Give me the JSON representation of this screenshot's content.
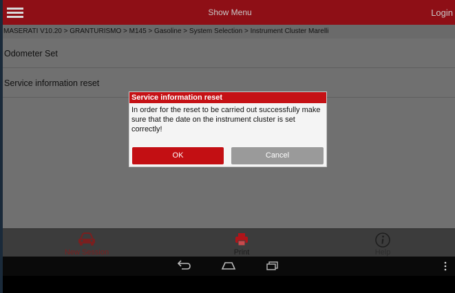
{
  "topbar": {
    "title": "Show Menu",
    "login_label": "Login"
  },
  "breadcrumb": "MASERATI V10.20 > GRANTURISMO > M145 > Gasoline > System Selection > Instrument Cluster Marelli",
  "list": {
    "items": [
      {
        "label": "Odometer Set"
      },
      {
        "label": "Service information reset"
      }
    ]
  },
  "dialog": {
    "title": "Service information reset",
    "message": "In order for the reset to be carried out successfully make sure that the date on the instrument cluster is set correctly!",
    "ok_label": "OK",
    "cancel_label": "Cancel"
  },
  "toolbar": {
    "new_session_label": "New Session",
    "print_label": "Print",
    "help_label": "Help"
  },
  "colors": {
    "brand_red": "#8e0f16",
    "dialog_red": "#c51115",
    "ok_button": "#c30f13",
    "cancel_button": "#9a9a9a"
  },
  "icons": [
    "menu-icon",
    "car-icon",
    "printer-icon",
    "info-icon",
    "back-icon",
    "home-icon",
    "recent-apps-icon",
    "more-icon"
  ]
}
